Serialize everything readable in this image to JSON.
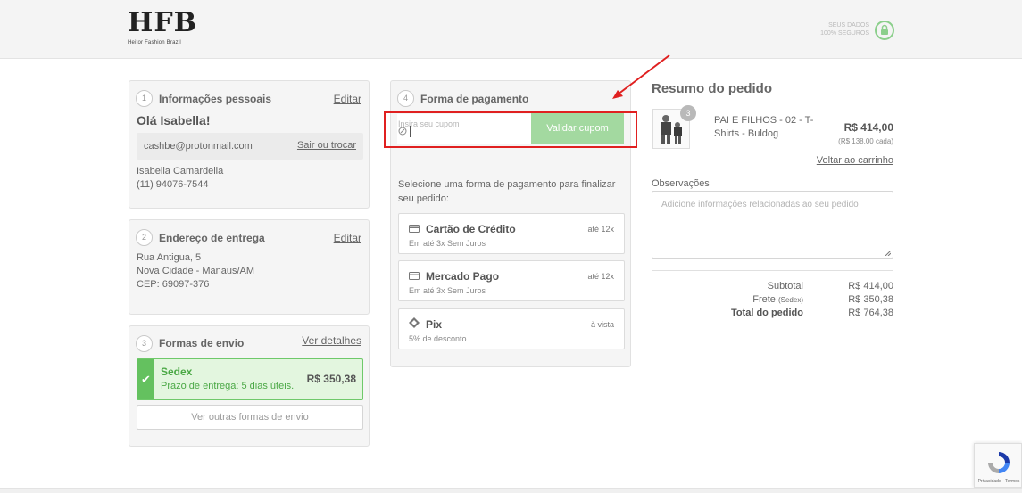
{
  "header": {
    "logo_mark": "HFB",
    "logo_sub": "Heitor Fashion Brazil",
    "secure_line1": "SEUS DADOS",
    "secure_line2": "100% SEGUROS",
    "secure_icon": "lock-icon"
  },
  "personal": {
    "step": "1",
    "title": "Informações pessoais",
    "edit_label": "Editar",
    "greeting": "Olá Isabella!",
    "email": "cashbe@protonmail.com",
    "switch_label": "Sair ou trocar",
    "name": "Isabella Camardella",
    "phone": "(11) 94076-7544"
  },
  "address": {
    "step": "2",
    "title": "Endereço de entrega",
    "edit_label": "Editar",
    "line1": "Rua Antigua, 5",
    "line2": "Nova Cidade - Manaus/AM",
    "line3": "CEP: 69097-376"
  },
  "shipping": {
    "step": "3",
    "title": "Formas de envio",
    "details_label": "Ver detalhes",
    "selected_name": "Sedex",
    "selected_time": "Prazo de entrega: 5 dias úteis.",
    "selected_price": "R$ 350,38",
    "other_label": "Ver outras formas de envio",
    "check_icon": "check-icon"
  },
  "payment": {
    "step": "4",
    "title": "Forma de pagamento",
    "coupon_placeholder": "Insira seu cupom",
    "coupon_button": "Validar cupom",
    "instructions": "Selecione uma forma de pagamento para finalizar seu pedido:",
    "options": [
      {
        "name": "Cartão de Crédito",
        "sub": "Em até 3x Sem Juros",
        "tag": "até 12x",
        "icon": "credit-card-icon"
      },
      {
        "name": "Mercado Pago",
        "sub": "Em até 3x Sem Juros",
        "tag": "até 12x",
        "icon": "credit-card-icon"
      },
      {
        "name": "Pix",
        "sub": "5% de desconto",
        "tag": "à vista",
        "icon": "pix-icon"
      }
    ]
  },
  "summary": {
    "title": "Resumo do pedido",
    "product": {
      "name_line1": "PAI E FILHOS - 02 - T-",
      "name_line2": "Shirts - Buldog",
      "quantity": "3",
      "price": "R$ 414,00",
      "unit_price": "(R$ 138,00 cada)"
    },
    "back_label": "Voltar ao carrinho",
    "notes_label": "Observações",
    "notes_placeholder": "Adicione informações relacionadas ao seu pedido",
    "subtotal_label": "Subtotal",
    "subtotal_value": "R$ 414,00",
    "shipping_label": "Frete",
    "shipping_method": "(Sedex)",
    "shipping_value": "R$ 350,38",
    "total_label": "Total do pedido",
    "total_value": "R$ 764,38"
  },
  "recaptcha": {
    "footer": "Privacidade - Termos"
  },
  "colors": {
    "accent_green": "#64c15f",
    "coupon_button": "#a3d9a0",
    "highlight_red": "#e02020"
  }
}
